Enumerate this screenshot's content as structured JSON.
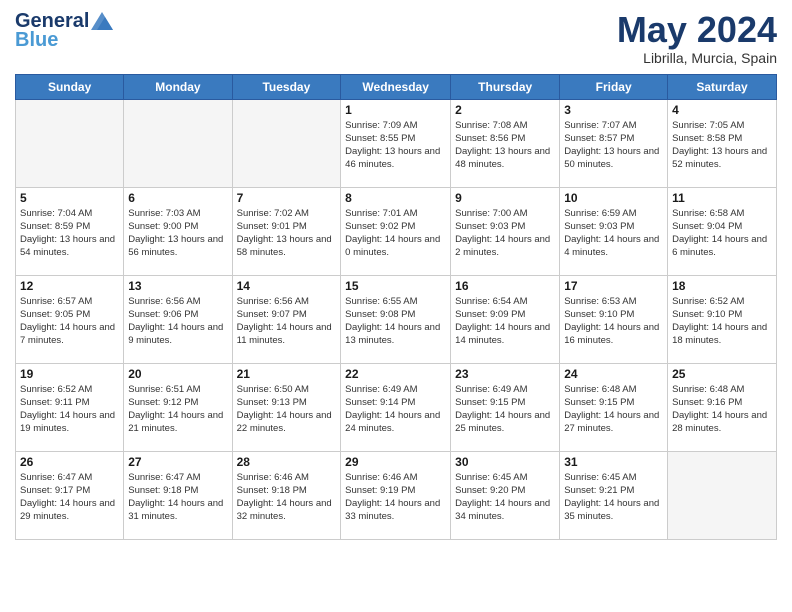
{
  "header": {
    "logo_general": "General",
    "logo_blue": "Blue",
    "month_year": "May 2024",
    "location": "Librilla, Murcia, Spain"
  },
  "days_of_week": [
    "Sunday",
    "Monday",
    "Tuesday",
    "Wednesday",
    "Thursday",
    "Friday",
    "Saturday"
  ],
  "weeks": [
    [
      {
        "day": "",
        "empty": true
      },
      {
        "day": "",
        "empty": true
      },
      {
        "day": "",
        "empty": true
      },
      {
        "day": "1",
        "sunrise": "7:09 AM",
        "sunset": "8:55 PM",
        "daylight": "13 hours and 46 minutes."
      },
      {
        "day": "2",
        "sunrise": "7:08 AM",
        "sunset": "8:56 PM",
        "daylight": "13 hours and 48 minutes."
      },
      {
        "day": "3",
        "sunrise": "7:07 AM",
        "sunset": "8:57 PM",
        "daylight": "13 hours and 50 minutes."
      },
      {
        "day": "4",
        "sunrise": "7:05 AM",
        "sunset": "8:58 PM",
        "daylight": "13 hours and 52 minutes."
      }
    ],
    [
      {
        "day": "5",
        "sunrise": "7:04 AM",
        "sunset": "8:59 PM",
        "daylight": "13 hours and 54 minutes."
      },
      {
        "day": "6",
        "sunrise": "7:03 AM",
        "sunset": "9:00 PM",
        "daylight": "13 hours and 56 minutes."
      },
      {
        "day": "7",
        "sunrise": "7:02 AM",
        "sunset": "9:01 PM",
        "daylight": "13 hours and 58 minutes."
      },
      {
        "day": "8",
        "sunrise": "7:01 AM",
        "sunset": "9:02 PM",
        "daylight": "14 hours and 0 minutes."
      },
      {
        "day": "9",
        "sunrise": "7:00 AM",
        "sunset": "9:03 PM",
        "daylight": "14 hours and 2 minutes."
      },
      {
        "day": "10",
        "sunrise": "6:59 AM",
        "sunset": "9:03 PM",
        "daylight": "14 hours and 4 minutes."
      },
      {
        "day": "11",
        "sunrise": "6:58 AM",
        "sunset": "9:04 PM",
        "daylight": "14 hours and 6 minutes."
      }
    ],
    [
      {
        "day": "12",
        "sunrise": "6:57 AM",
        "sunset": "9:05 PM",
        "daylight": "14 hours and 7 minutes."
      },
      {
        "day": "13",
        "sunrise": "6:56 AM",
        "sunset": "9:06 PM",
        "daylight": "14 hours and 9 minutes."
      },
      {
        "day": "14",
        "sunrise": "6:56 AM",
        "sunset": "9:07 PM",
        "daylight": "14 hours and 11 minutes."
      },
      {
        "day": "15",
        "sunrise": "6:55 AM",
        "sunset": "9:08 PM",
        "daylight": "14 hours and 13 minutes."
      },
      {
        "day": "16",
        "sunrise": "6:54 AM",
        "sunset": "9:09 PM",
        "daylight": "14 hours and 14 minutes."
      },
      {
        "day": "17",
        "sunrise": "6:53 AM",
        "sunset": "9:10 PM",
        "daylight": "14 hours and 16 minutes."
      },
      {
        "day": "18",
        "sunrise": "6:52 AM",
        "sunset": "9:10 PM",
        "daylight": "14 hours and 18 minutes."
      }
    ],
    [
      {
        "day": "19",
        "sunrise": "6:52 AM",
        "sunset": "9:11 PM",
        "daylight": "14 hours and 19 minutes."
      },
      {
        "day": "20",
        "sunrise": "6:51 AM",
        "sunset": "9:12 PM",
        "daylight": "14 hours and 21 minutes."
      },
      {
        "day": "21",
        "sunrise": "6:50 AM",
        "sunset": "9:13 PM",
        "daylight": "14 hours and 22 minutes."
      },
      {
        "day": "22",
        "sunrise": "6:49 AM",
        "sunset": "9:14 PM",
        "daylight": "14 hours and 24 minutes."
      },
      {
        "day": "23",
        "sunrise": "6:49 AM",
        "sunset": "9:15 PM",
        "daylight": "14 hours and 25 minutes."
      },
      {
        "day": "24",
        "sunrise": "6:48 AM",
        "sunset": "9:15 PM",
        "daylight": "14 hours and 27 minutes."
      },
      {
        "day": "25",
        "sunrise": "6:48 AM",
        "sunset": "9:16 PM",
        "daylight": "14 hours and 28 minutes."
      }
    ],
    [
      {
        "day": "26",
        "sunrise": "6:47 AM",
        "sunset": "9:17 PM",
        "daylight": "14 hours and 29 minutes."
      },
      {
        "day": "27",
        "sunrise": "6:47 AM",
        "sunset": "9:18 PM",
        "daylight": "14 hours and 31 minutes."
      },
      {
        "day": "28",
        "sunrise": "6:46 AM",
        "sunset": "9:18 PM",
        "daylight": "14 hours and 32 minutes."
      },
      {
        "day": "29",
        "sunrise": "6:46 AM",
        "sunset": "9:19 PM",
        "daylight": "14 hours and 33 minutes."
      },
      {
        "day": "30",
        "sunrise": "6:45 AM",
        "sunset": "9:20 PM",
        "daylight": "14 hours and 34 minutes."
      },
      {
        "day": "31",
        "sunrise": "6:45 AM",
        "sunset": "9:21 PM",
        "daylight": "14 hours and 35 minutes."
      },
      {
        "day": "",
        "empty": true
      }
    ]
  ]
}
